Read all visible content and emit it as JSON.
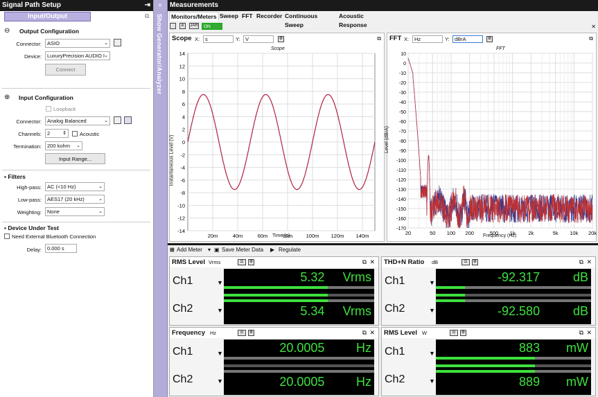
{
  "left": {
    "title": "Signal Path Setup",
    "tab": "Input/Output",
    "output": {
      "heading": "Output Configuration",
      "connector_label": "Connector:",
      "connector_value": "ASIO",
      "device_label": "Device:",
      "device_value": "LuxuryPrecision AUDIO I",
      "connect_button": "Connect"
    },
    "input": {
      "heading": "Input Configuration",
      "loopback": "Loopback",
      "connector_label": "Connector:",
      "connector_value": "Analog Balanced",
      "channels_label": "Channels:",
      "channels_value": "2",
      "acoustic": "Acoustic",
      "termination_label": "Termination:",
      "termination_value": "200 kohm",
      "range_button": "Input Range..."
    },
    "filters": {
      "heading": "Filters",
      "highpass_label": "High-pass:",
      "highpass_value": "AC (<10 Hz)",
      "lowpass_label": "Low-pass:",
      "lowpass_value": "AES17 (20 kHz)",
      "weighting_label": "Weighting:",
      "weighting_value": "None"
    },
    "dut": {
      "heading": "Device Under Test",
      "bt": "Need External Bluetooth Connection",
      "delay_label": "Delay:",
      "delay_value": "0.000 s"
    }
  },
  "generator": {
    "label": "Show Generator/Analyzer"
  },
  "measurements": {
    "title": "Measurements",
    "tabs": [
      "Monitors/Meters",
      "Sweep",
      "FFT",
      "Recorder",
      "Continuous Sweep",
      "Acoustic Response"
    ],
    "on_label": "ON",
    "scope": {
      "title": "Scope",
      "x_label": "X:",
      "x_unit": "s",
      "y_label": "Y:",
      "y_unit": "V",
      "plot_title": "Scope",
      "ylabel": "Instantaneous Level (V)",
      "xlabel": "Time (s)"
    },
    "fft": {
      "title": "FFT",
      "x_label": "X:",
      "x_unit": "Hz",
      "y_label": "Y:",
      "y_unit": "dBrA",
      "plot_title": "FFT",
      "ylabel": "Level (dBrA)",
      "xlabel": "Frequency (Hz)"
    },
    "meter_bar": {
      "add": "Add Meter",
      "save": "Save Meter Data",
      "regulate": "Regulate"
    }
  },
  "meters": {
    "rms_v": {
      "title": "RMS Level",
      "unit_sel": "Vrms",
      "ch1": "Ch1",
      "ch2": "Ch2",
      "v1": "5.32",
      "v2": "5.34",
      "unit": "Vrms"
    },
    "thdn": {
      "title": "THD+N Ratio",
      "unit_sel": "dB",
      "ch1": "Ch1",
      "ch2": "Ch2",
      "v1": "-92.317",
      "v2": "-92.580",
      "unit": "dB"
    },
    "freq": {
      "title": "Frequency",
      "unit_sel": "Hz",
      "ch1": "Ch1",
      "ch2": "Ch2",
      "v1": "20.0005",
      "v2": "20.0005",
      "unit": "Hz"
    },
    "rms_w": {
      "title": "RMS Level",
      "unit_sel": "W",
      "ch1": "Ch1",
      "ch2": "Ch2",
      "v1": "883",
      "v2": "889",
      "unit": "mW"
    }
  },
  "chart_data": [
    {
      "type": "line",
      "title": "Scope",
      "xlabel": "Time (s)",
      "ylabel": "Instantaneous Level (V)",
      "xlim": [
        0,
        0.15
      ],
      "ylim": [
        -14,
        14
      ],
      "x_ticks": [
        "20m",
        "40m",
        "60m",
        "80m",
        "100m",
        "120m",
        "140m"
      ],
      "y_ticks": [
        "14",
        "12",
        "10",
        "8",
        "6",
        "4",
        "2",
        "0",
        "-2",
        "-4",
        "-6",
        "-8",
        "-10",
        "-12",
        "-14"
      ],
      "series": [
        {
          "amplitude": 7.5,
          "frequency_hz": 20,
          "color": "#b02040"
        }
      ],
      "grid": true
    },
    {
      "type": "line",
      "title": "FFT",
      "xlabel": "Frequency (Hz)",
      "ylabel": "Level (dBrA)",
      "x_scale": "log",
      "xlim": [
        20,
        20000
      ],
      "ylim": [
        -170,
        10
      ],
      "x_ticks": [
        "20",
        "50",
        "100",
        "200",
        "500",
        "1k",
        "2k",
        "5k",
        "10k",
        "20k"
      ],
      "y_ticks": [
        "10",
        "0",
        "-10",
        "-20",
        "-30",
        "-40",
        "-50",
        "-60",
        "-70",
        "-80",
        "-90",
        "-100",
        "-110",
        "-120",
        "-130",
        "-140",
        "-150",
        "-160",
        "-170"
      ],
      "series": [
        {
          "color": "#2a3a9a"
        },
        {
          "color": "#c03030"
        }
      ],
      "grid": true
    }
  ]
}
